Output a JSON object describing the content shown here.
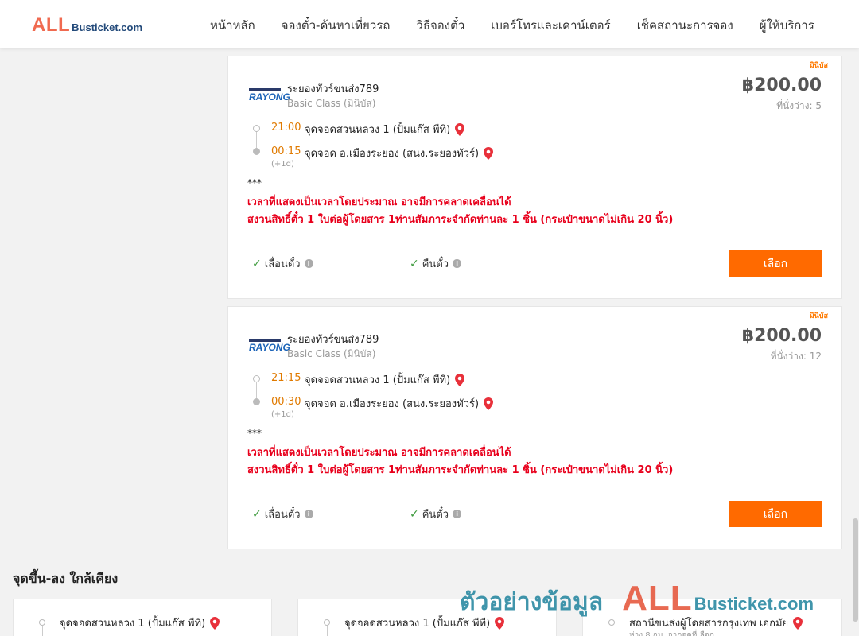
{
  "header": {
    "logo_all": "ALL",
    "logo_rest": "Busticket.com",
    "nav": [
      "หน้าหลัก",
      "จองตั๋ว-ค้นหาเที่ยวรถ",
      "วิธีจองตั๋ว",
      "เบอร์โทรและเคาน์เตอร์",
      "เช็คสถานะการจอง",
      "ผู้ให้บริการ"
    ]
  },
  "trips": [
    {
      "tag": "มินิบัส",
      "logo_text": "RAYONG",
      "operator": "ระยองทัวร์ขนส่ง789",
      "class": "Basic Class (มินิบัส)",
      "price": "฿200.00",
      "seats": "ที่นั่งว่าง: 5",
      "dep_time": "21:00",
      "dep_place": "จุดจอดสวนหลวง 1 (ปั้มแก๊ส พีที)",
      "arr_time": "00:15",
      "arr_place": "จุดจอด อ.เมืองระยอง (สนง.ระยองทัวร์)",
      "next_day": "(+1d)",
      "stars": "***",
      "warning1": "เวลาที่แสดงเป็นเวลาโดยประมาณ อาจมีการคลาดเคลื่อนได้",
      "warning2": "สงวนสิทธิ์ตั๋ว 1 ใบต่อผู้โดยสาร 1ท่านสัมภาระจำกัดท่านละ 1 ชิ้น (กระเป๋าขนาดไม่เกิน 20 นิ้ว)",
      "opt1": "เลื่อนตั๋ว",
      "opt2": "คืนตั๋ว",
      "button": "เลือก"
    },
    {
      "tag": "มินิบัส",
      "logo_text": "RAYONG",
      "operator": "ระยองทัวร์ขนส่ง789",
      "class": "Basic Class (มินิบัส)",
      "price": "฿200.00",
      "seats": "ที่นั่งว่าง: 12",
      "dep_time": "21:15",
      "dep_place": "จุดจอดสวนหลวง 1 (ปั้มแก๊ส พีที)",
      "arr_time": "00:30",
      "arr_place": "จุดจอด อ.เมืองระยอง (สนง.ระยองทัวร์)",
      "next_day": "(+1d)",
      "stars": "***",
      "warning1": "เวลาที่แสดงเป็นเวลาโดยประมาณ อาจมีการคลาดเคลื่อนได้",
      "warning2": "สงวนสิทธิ์ตั๋ว 1 ใบต่อผู้โดยสาร 1ท่านสัมภาระจำกัดท่านละ 1 ชิ้น (กระเป๋าขนาดไม่เกิน 20 นิ้ว)",
      "opt1": "เลื่อนตั๋ว",
      "opt2": "คืนตั๋ว",
      "button": "เลือก"
    }
  ],
  "nearby": {
    "title": "จุดขึ้น-ลง ใกล้เคียง",
    "items": [
      {
        "name": "จุดจอดสวนหลวง 1 (ปั้มแก๊ส พีที)",
        "sub": ""
      },
      {
        "name": "จุดจอดสวนหลวง 1 (ปั้มแก๊ส พีที)",
        "sub": ""
      },
      {
        "name": "สถานีขนส่งผู้โดยสารกรุงเทพ เอกมัย",
        "sub": "ห่าง 8 กม. จากจุดที่เลือก"
      }
    ]
  },
  "watermark": {
    "thai": "ตัวอย่างข้อมูล",
    "all": "ALL",
    "rest": "Busticket.com"
  },
  "colors": {
    "accent": "#ff6a00",
    "time": "#e07a00",
    "warning": "#e8001c",
    "check": "#3c9a3c"
  }
}
